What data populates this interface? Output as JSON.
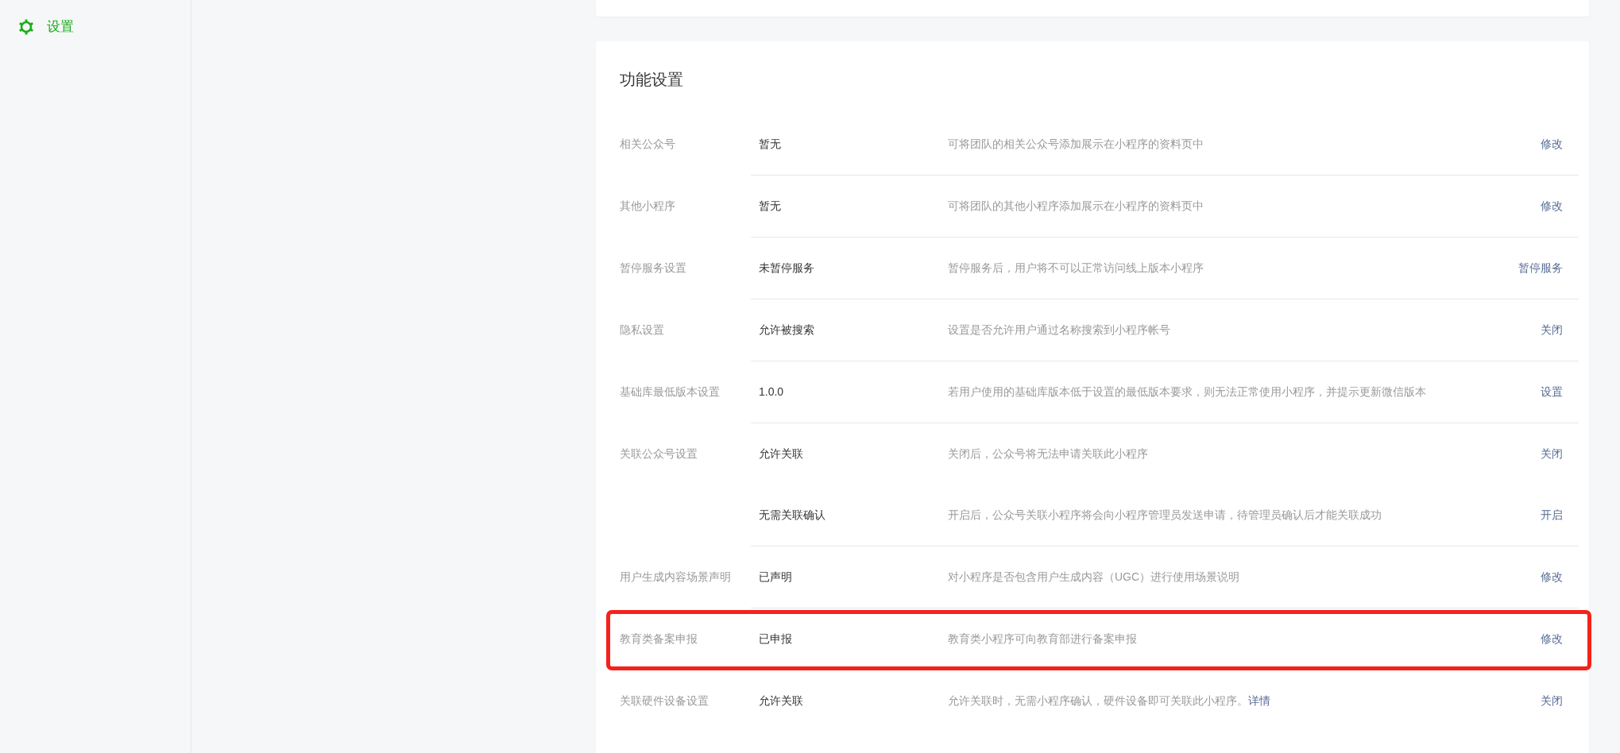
{
  "sidebar": {
    "items": [
      {
        "label": "设置",
        "selected": true
      }
    ]
  },
  "section": {
    "title": "功能设置",
    "groups": [
      {
        "label": "相关公众号",
        "highlighted": false,
        "entries": [
          {
            "value": "暂无",
            "description": "可将团队的相关公众号添加展示在小程序的资料页中",
            "action": "修改"
          }
        ]
      },
      {
        "label": "其他小程序",
        "highlighted": false,
        "entries": [
          {
            "value": "暂无",
            "description": "可将团队的其他小程序添加展示在小程序的资料页中",
            "action": "修改"
          }
        ]
      },
      {
        "label": "暂停服务设置",
        "highlighted": false,
        "entries": [
          {
            "value": "未暂停服务",
            "description": "暂停服务后，用户将不可以正常访问线上版本小程序",
            "action": "暂停服务"
          }
        ]
      },
      {
        "label": "隐私设置",
        "highlighted": false,
        "entries": [
          {
            "value": "允许被搜索",
            "description": "设置是否允许用户通过名称搜索到小程序帐号",
            "action": "关闭"
          }
        ]
      },
      {
        "label": "基础库最低版本设置",
        "highlighted": false,
        "entries": [
          {
            "value": "1.0.0",
            "description": "若用户使用的基础库版本低于设置的最低版本要求，则无法正常使用小程序，并提示更新微信版本",
            "action": "设置"
          }
        ]
      },
      {
        "label": "关联公众号设置",
        "highlighted": false,
        "entries": [
          {
            "value": "允许关联",
            "description": "关闭后，公众号将无法申请关联此小程序",
            "action": "关闭"
          },
          {
            "value": "无需关联确认",
            "description": "开启后，公众号关联小程序将会向小程序管理员发送申请，待管理员确认后才能关联成功",
            "action": "开启"
          }
        ]
      },
      {
        "label": "用户生成内容场景声明",
        "highlighted": false,
        "entries": [
          {
            "value": "已声明",
            "description": "对小程序是否包含用户生成内容（UGC）进行使用场景说明",
            "action": "修改"
          }
        ]
      },
      {
        "label": "教育类备案申报",
        "highlighted": true,
        "entries": [
          {
            "value": "已申报",
            "description": "教育类小程序可向教育部进行备案申报",
            "action": "修改"
          }
        ]
      },
      {
        "label": "关联硬件设备设置",
        "highlighted": false,
        "entries": [
          {
            "value": "允许关联",
            "description": "允许关联时，无需小程序确认，硬件设备即可关联此小程序。",
            "link": "详情",
            "action": "关闭"
          }
        ]
      }
    ]
  }
}
